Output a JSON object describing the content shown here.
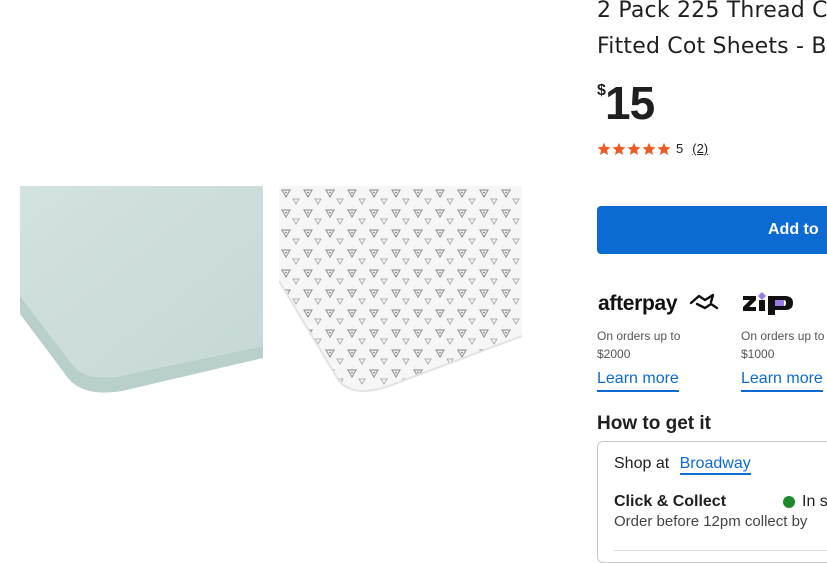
{
  "product": {
    "title_line1": "2 Pack 225 Thread C",
    "title_line2": "Fitted Cot Sheets - B",
    "currency": "$",
    "price": "15",
    "rating": {
      "score": "5",
      "count": "(2)",
      "stars": 5,
      "star_color": "#f05a22"
    }
  },
  "images": [
    {
      "icon": "plain-mint-fitted-sheet-image"
    },
    {
      "icon": "patterned-fitted-sheet-image"
    }
  ],
  "cart": {
    "add_label": "Add to"
  },
  "payments": [
    {
      "brand": "afterpay",
      "note_line1": "On orders up to",
      "note_line2": "$2000",
      "link": "Learn more"
    },
    {
      "brand": "zip",
      "note_line1": "On orders up to",
      "note_line2": "$1000",
      "link": "Learn more"
    }
  ],
  "fulfilment": {
    "heading": "How to get it",
    "shop_at_label": "Shop at",
    "store_name": "Broadway",
    "click_collect_title": "Click & Collect",
    "stock_status": "In s",
    "click_collect_sub": "Order before 12pm collect by"
  },
  "colors": {
    "accent": "#0b6bd3",
    "in_stock": "#1a8a2b",
    "zip_purple": "#9b7ae8"
  }
}
